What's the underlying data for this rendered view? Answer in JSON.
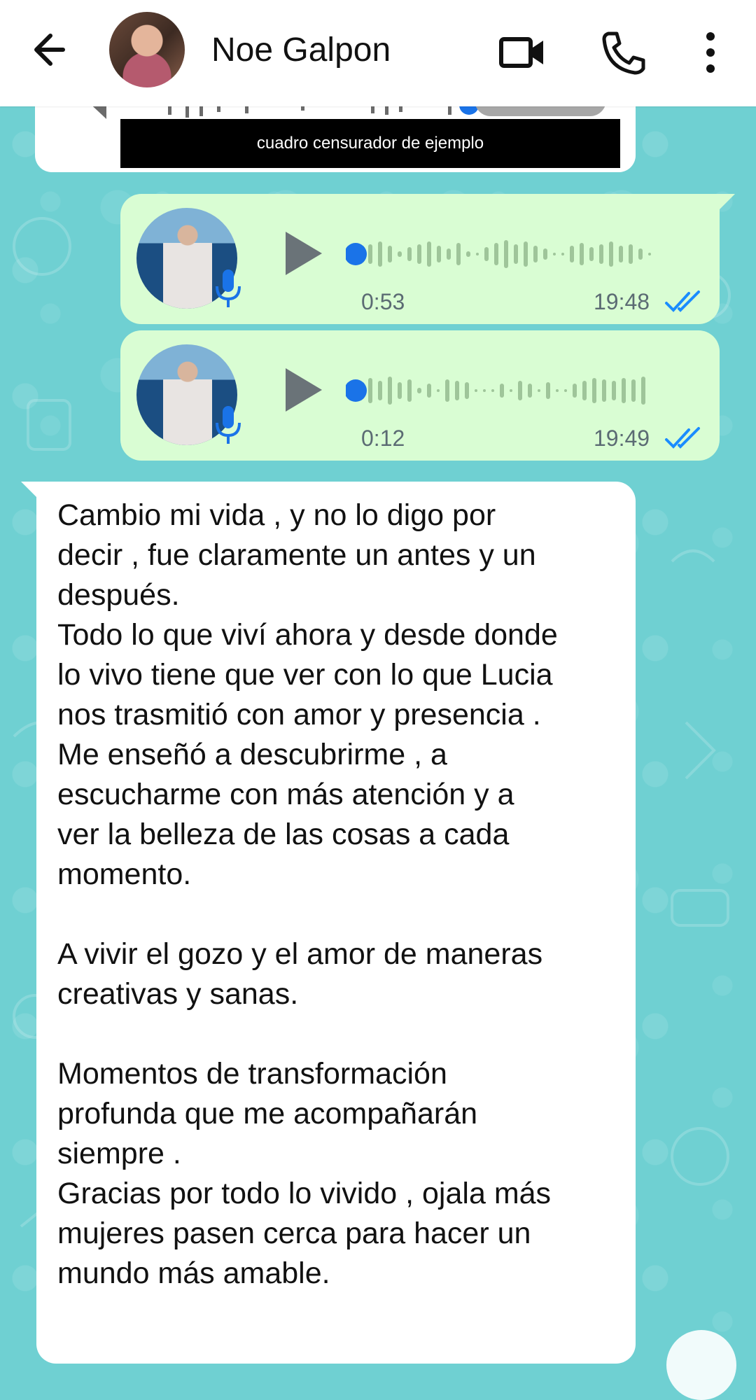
{
  "header": {
    "contact_name": "Noe Galpon",
    "icons": [
      "back-arrow-icon",
      "video-call-icon",
      "phone-icon",
      "more-vert-icon"
    ]
  },
  "censor": {
    "label": "cuadro censurador de ejemplo"
  },
  "voice_messages": [
    {
      "duration": "0:53",
      "time": "19:48",
      "status": "read"
    },
    {
      "duration": "0:12",
      "time": "19:49",
      "status": "read"
    }
  ],
  "message": {
    "text": "Cambio mi vida , y no lo digo por\ndecir , fue claramente un antes y un\ndespués.\nTodo lo que viví ahora y desde donde\nlo vivo tiene que ver con lo que Lucia\nnos trasmitió con amor y presencia .\nMe enseñó a descubrirme , a\nescucharme con más atención y a\nver la belleza de las cosas a cada\nmomento.\n\nA vivir el gozo y el amor de maneras\ncreativas y sanas.\n\nMomentos de transformación\nprofunda que me acompañarán\nsiempre .\nGracias por todo lo vivido , ojala más\nmujeres pasen cerca para hacer un\nmundo más amable."
  },
  "colors": {
    "wallpaper": "#6fd0d2",
    "outgoing_bubble": "#d9fdd3",
    "incoming_bubble": "#ffffff",
    "read_ticks": "#1a8cff",
    "play_dot": "#1a73e8"
  }
}
